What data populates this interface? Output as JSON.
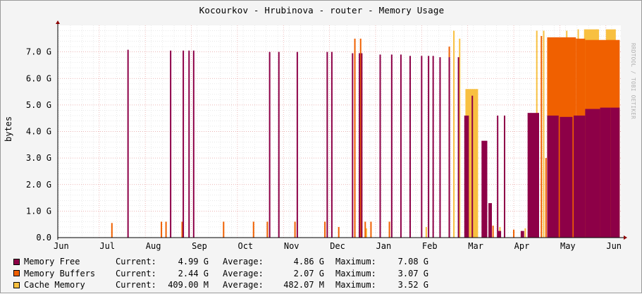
{
  "chart_data": {
    "type": "area",
    "title": "Kocourkov - Hrubinova - router - Memory Usage",
    "ylabel": "bytes",
    "watermark": "RRDTOOL / TOBI OETIKER",
    "ylim": [
      0,
      8
    ],
    "y_ticks": [
      "0.0",
      "1.0 G",
      "2.0 G",
      "3.0 G",
      "4.0 G",
      "5.0 G",
      "6.0 G",
      "7.0 G"
    ],
    "x_ticks": [
      "Jun",
      "Jul",
      "Aug",
      "Sep",
      "Oct",
      "Nov",
      "Dec",
      "Jan",
      "Feb",
      "Mar",
      "Apr",
      "May",
      "Jun"
    ],
    "grid": true,
    "stacked": true,
    "colors": {
      "memory_free": "#8d0047",
      "memory_buffers": "#f06000",
      "cache_memory": "#f8c040",
      "grid_major": "#e8a0a0",
      "grid_minor": "#dcdcdc",
      "background": "#ffffff",
      "frame": "#f4f4f4"
    },
    "series": [
      {
        "name": "Memory Free",
        "color": "#8d0047",
        "spikes": [
          {
            "t": 3.25,
            "v": 7.08
          },
          {
            "t": 5.1,
            "v": 7.05
          },
          {
            "t": 5.65,
            "v": 7.05
          },
          {
            "t": 5.9,
            "v": 7.05
          },
          {
            "t": 6.1,
            "v": 7.05
          },
          {
            "t": 9.4,
            "v": 7.0
          },
          {
            "t": 9.8,
            "v": 7.0
          },
          {
            "t": 10.6,
            "v": 7.0
          },
          {
            "t": 11.9,
            "v": 7.0
          },
          {
            "t": 12.1,
            "v": 7.0
          },
          {
            "t": 13.0,
            "v": 6.95
          },
          {
            "t": 13.3,
            "v": 6.95
          },
          {
            "t": 13.4,
            "v": 6.95
          },
          {
            "t": 14.2,
            "v": 6.9
          },
          {
            "t": 14.7,
            "v": 6.9
          },
          {
            "t": 15.1,
            "v": 6.9
          },
          {
            "t": 15.5,
            "v": 6.85
          },
          {
            "t": 16.0,
            "v": 6.85
          },
          {
            "t": 16.3,
            "v": 6.85
          },
          {
            "t": 16.5,
            "v": 6.85
          },
          {
            "t": 16.8,
            "v": 6.8
          },
          {
            "t": 17.2,
            "v": 6.8
          },
          {
            "t": 17.6,
            "v": 6.8
          },
          {
            "t": 18.2,
            "v": 5.35
          },
          {
            "t": 19.3,
            "v": 4.6
          },
          {
            "t": 19.6,
            "v": 4.6
          },
          {
            "t": 21.8,
            "v": 4.55
          }
        ],
        "blocks": [
          {
            "t0": 18.6,
            "t1": 18.85,
            "v": 3.65
          },
          {
            "t0": 17.85,
            "t1": 18.05,
            "v": 4.6
          },
          {
            "t0": 20.6,
            "t1": 21.1,
            "v": 4.7
          },
          {
            "t0": 21.45,
            "t1": 21.95,
            "v": 4.6
          },
          {
            "t0": 22.0,
            "t1": 22.55,
            "v": 4.55
          },
          {
            "t0": 22.6,
            "t1": 23.1,
            "v": 4.6
          },
          {
            "t0": 23.1,
            "t1": 23.75,
            "v": 4.85
          },
          {
            "t0": 23.75,
            "t1": 24.2,
            "v": 4.9
          },
          {
            "t0": 24.2,
            "t1": 24.6,
            "v": 4.9
          },
          {
            "t0": 18.9,
            "t1": 19.05,
            "v": 1.3
          },
          {
            "t0": 19.3,
            "t1": 19.45,
            "v": 0.25
          },
          {
            "t0": 20.3,
            "t1": 20.45,
            "v": 0.25
          }
        ]
      },
      {
        "name": "Memory Buffers",
        "color": "#f06000",
        "spikes": [
          {
            "t": 2.55,
            "v": 0.55
          },
          {
            "t": 4.7,
            "v": 0.6
          },
          {
            "t": 4.9,
            "v": 0.6
          },
          {
            "t": 5.6,
            "v": 0.6
          },
          {
            "t": 7.4,
            "v": 0.6
          },
          {
            "t": 8.7,
            "v": 0.6
          },
          {
            "t": 9.3,
            "v": 0.6
          },
          {
            "t": 10.5,
            "v": 0.6
          },
          {
            "t": 11.8,
            "v": 0.6
          },
          {
            "t": 12.4,
            "v": 0.4
          },
          {
            "t": 13.1,
            "v": 7.5
          },
          {
            "t": 13.35,
            "v": 7.5
          },
          {
            "t": 13.55,
            "v": 0.6
          },
          {
            "t": 13.8,
            "v": 0.6
          },
          {
            "t": 14.6,
            "v": 0.6
          },
          {
            "t": 17.2,
            "v": 7.2
          },
          {
            "t": 19.1,
            "v": 0.45
          },
          {
            "t": 20.0,
            "v": 0.3
          },
          {
            "t": 21.2,
            "v": 7.6
          },
          {
            "t": 21.4,
            "v": 3.0
          }
        ],
        "blocks": [
          {
            "t0": 21.45,
            "t1": 22.7,
            "v": 7.55
          },
          {
            "t0": 22.7,
            "t1": 23.1,
            "v": 7.5
          },
          {
            "t0": 23.1,
            "t1": 24.6,
            "v": 7.45
          }
        ]
      },
      {
        "name": "Cache Memory",
        "color": "#f8c040",
        "spikes": [
          {
            "t": 13.6,
            "v": 0.35
          },
          {
            "t": 16.2,
            "v": 0.4
          },
          {
            "t": 17.4,
            "v": 7.8
          },
          {
            "t": 17.65,
            "v": 7.5
          },
          {
            "t": 18.15,
            "v": 4.8
          },
          {
            "t": 19.4,
            "v": 0.4
          },
          {
            "t": 20.5,
            "v": 0.35
          },
          {
            "t": 21.3,
            "v": 7.8
          },
          {
            "t": 21.0,
            "v": 7.8
          },
          {
            "t": 22.3,
            "v": 7.8
          },
          {
            "t": 22.8,
            "v": 7.85
          },
          {
            "t": 23.6,
            "v": 7.85
          },
          {
            "t": 24.4,
            "v": 7.85
          }
        ],
        "blocks": [
          {
            "t0": 17.9,
            "t1": 18.45,
            "v": 5.6
          },
          {
            "t0": 23.05,
            "t1": 23.7,
            "v": 7.85
          },
          {
            "t0": 24.0,
            "t1": 24.4,
            "v": 7.85
          }
        ]
      }
    ]
  },
  "legend": [
    {
      "name": "Memory Free",
      "color": "#8d0047",
      "current_label": "Current:",
      "current": "4.99 G",
      "average_label": "Average:",
      "average": "4.86 G",
      "maximum_label": "Maximum:",
      "maximum": "7.08 G"
    },
    {
      "name": "Memory Buffers",
      "color": "#f06000",
      "current_label": "Current:",
      "current": "2.44 G",
      "average_label": "Average:",
      "average": "2.07 G",
      "maximum_label": "Maximum:",
      "maximum": "3.07 G"
    },
    {
      "name": "Cache Memory",
      "color": "#f8c040",
      "current_label": "Current:",
      "current": "409.00 M",
      "average_label": "Average:",
      "average": "482.07 M",
      "maximum_label": "Maximum:",
      "maximum": "3.52 G"
    }
  ]
}
